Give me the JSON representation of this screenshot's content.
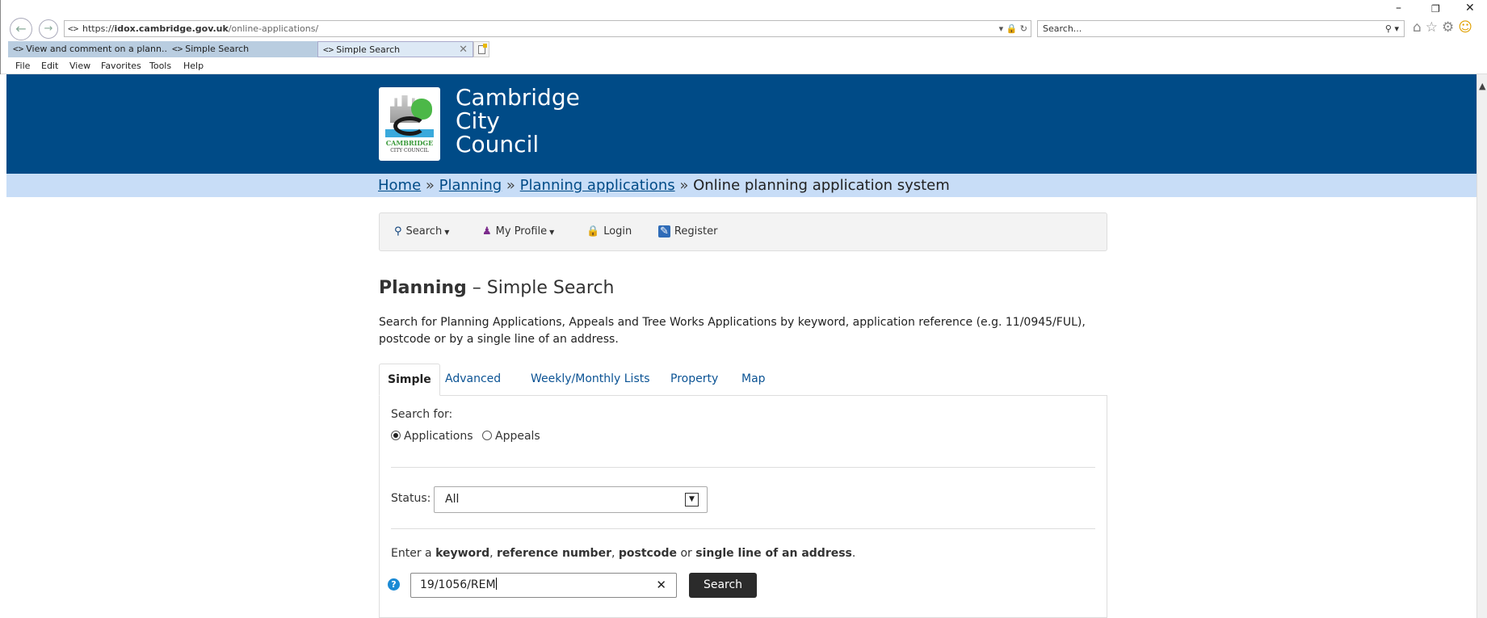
{
  "browser": {
    "url_prefix": "https://",
    "url_host": "idox.cambridge.gov.uk",
    "url_path": "/online-applications/",
    "search_placeholder": "Search...",
    "tabs": [
      {
        "label": "View and comment on a plann..."
      },
      {
        "label": "Simple Search"
      },
      {
        "label": "Simple Search"
      }
    ],
    "menu": [
      "File",
      "Edit",
      "View",
      "Favorites",
      "Tools",
      "Help"
    ]
  },
  "header": {
    "logo_text_1": "CAMBRIDGE",
    "logo_text_2": "CITY COUNCIL",
    "name_line_1": "Cambridge",
    "name_line_2": "City",
    "name_line_3": "Council"
  },
  "breadcrumb": {
    "home": "Home",
    "planning": "Planning",
    "applications": "Planning applications",
    "current": "Online planning application system",
    "separator": "»"
  },
  "nav": {
    "search": "Search",
    "profile": "My Profile",
    "login": "Login",
    "register": "Register"
  },
  "page": {
    "title_bold": "Planning",
    "title_dash": "–",
    "title_rest": "Simple Search",
    "intro": "Search for Planning Applications, Appeals and Tree Works Applications by keyword, application reference (e.g. 11/0945/FUL), postcode or by a single line of an address."
  },
  "tabs": [
    "Simple",
    "Advanced",
    "Weekly/Monthly Lists",
    "Property",
    "Map"
  ],
  "form": {
    "search_for_label": "Search for:",
    "radio_applications": "Applications",
    "radio_appeals": "Appeals",
    "selected_type": "Applications",
    "status_label": "Status:",
    "status_value": "All",
    "instruction_1": "Enter a ",
    "instruction_keyword": "keyword",
    "instruction_2": ", ",
    "instruction_reference": "reference number",
    "instruction_3": ", ",
    "instruction_postcode": "postcode",
    "instruction_4": " or ",
    "instruction_address": "single line of an address",
    "instruction_5": ".",
    "search_value": "19/1056/REM",
    "search_button": "Search"
  }
}
